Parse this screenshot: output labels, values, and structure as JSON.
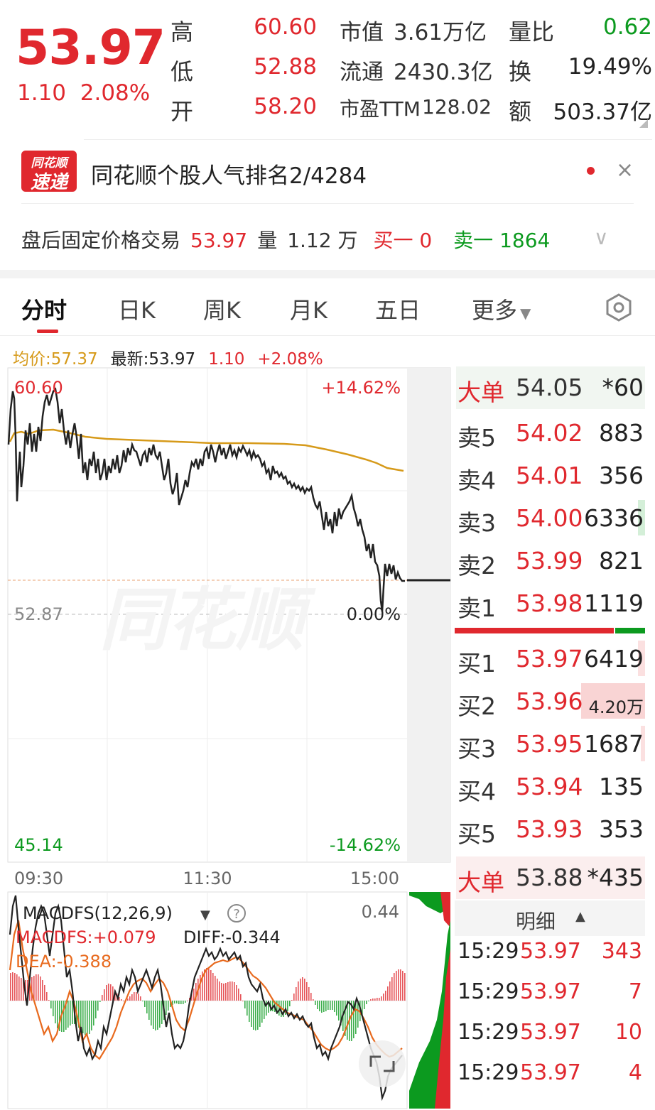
{
  "quote": {
    "price": "53.97",
    "change_abs": "1.10",
    "change_pct": "2.08%",
    "rows": [
      {
        "label": "高",
        "value": "60.60",
        "s_label": "市值",
        "s_value": "3.61万亿",
        "r_label": "量比",
        "r_value": "0.62"
      },
      {
        "label": "低",
        "value": "52.88",
        "s_label": "流通",
        "s_value": "2430.3亿",
        "r_label": "换",
        "r_value": "19.49%"
      },
      {
        "label": "开",
        "value": "58.20",
        "s_label": "市盈TTM",
        "s_value": "128.02",
        "r_label": "额",
        "r_value": "503.37亿"
      }
    ]
  },
  "banner": {
    "logo_line1": "同花顺",
    "logo_line2": "速递",
    "text": "同花顺个股人气排名2/4284",
    "close_glyph": "×"
  },
  "after_hours": {
    "label": "盘后固定价格交易",
    "price": "53.97",
    "vol_label": "量",
    "vol_value": "1.12 万",
    "buy1": "买一 0",
    "sell1": "卖一 1864",
    "chevron_glyph": "∨"
  },
  "tabs": [
    "分时",
    "日K",
    "周K",
    "月K",
    "五日",
    "更多"
  ],
  "summary": {
    "avg": "均价:57.37",
    "latest": "最新:53.97",
    "change": "1.10",
    "pct": "+2.08%"
  },
  "chart_labels": {
    "high": "60.60",
    "high_pct": "+14.62%",
    "prev": "52.87",
    "prev_pct": "0.00%",
    "low": "45.14",
    "low_pct": "-14.62%",
    "times": [
      "09:30",
      "11:30",
      "15:00"
    ],
    "watermark": "同花顺"
  },
  "macd": {
    "title": "MACDFS(12,26,9)",
    "macdfs": "MACDFS:+0.079",
    "diff": "DIFF:-0.344",
    "dea": "DEA:-0.388",
    "top_value": "0.44"
  },
  "orderbook": {
    "big_top": {
      "label": "大单",
      "price": "54.05",
      "vol": "*60"
    },
    "sells": [
      {
        "label": "卖5",
        "price": "54.02",
        "vol": "883"
      },
      {
        "label": "卖4",
        "price": "54.01",
        "vol": "356"
      },
      {
        "label": "卖3",
        "price": "54.00",
        "vol": "6336"
      },
      {
        "label": "卖2",
        "price": "53.99",
        "vol": "821"
      },
      {
        "label": "卖1",
        "price": "53.98",
        "vol": "1119"
      }
    ],
    "buys": [
      {
        "label": "买1",
        "price": "53.97",
        "vol": "6419"
      },
      {
        "label": "买2",
        "price": "53.96",
        "vol": "4.20万"
      },
      {
        "label": "买3",
        "price": "53.95",
        "vol": "1687"
      },
      {
        "label": "买4",
        "price": "53.94",
        "vol": "135"
      },
      {
        "label": "买5",
        "price": "53.93",
        "vol": "353"
      }
    ],
    "big_bottom": {
      "label": "大单",
      "price": "53.88",
      "vol": "*435"
    },
    "detail_label": "明细"
  },
  "ticks": [
    {
      "time": "15:29",
      "price": "53.97",
      "vol": "343"
    },
    {
      "time": "15:29",
      "price": "53.97",
      "vol": "7"
    },
    {
      "time": "15:29",
      "price": "53.97",
      "vol": "10"
    },
    {
      "time": "15:29",
      "price": "53.97",
      "vol": "4"
    }
  ],
  "colors": {
    "up": "#e0282e",
    "down": "#0c9a1f",
    "avg_line": "#d69a1a"
  }
}
